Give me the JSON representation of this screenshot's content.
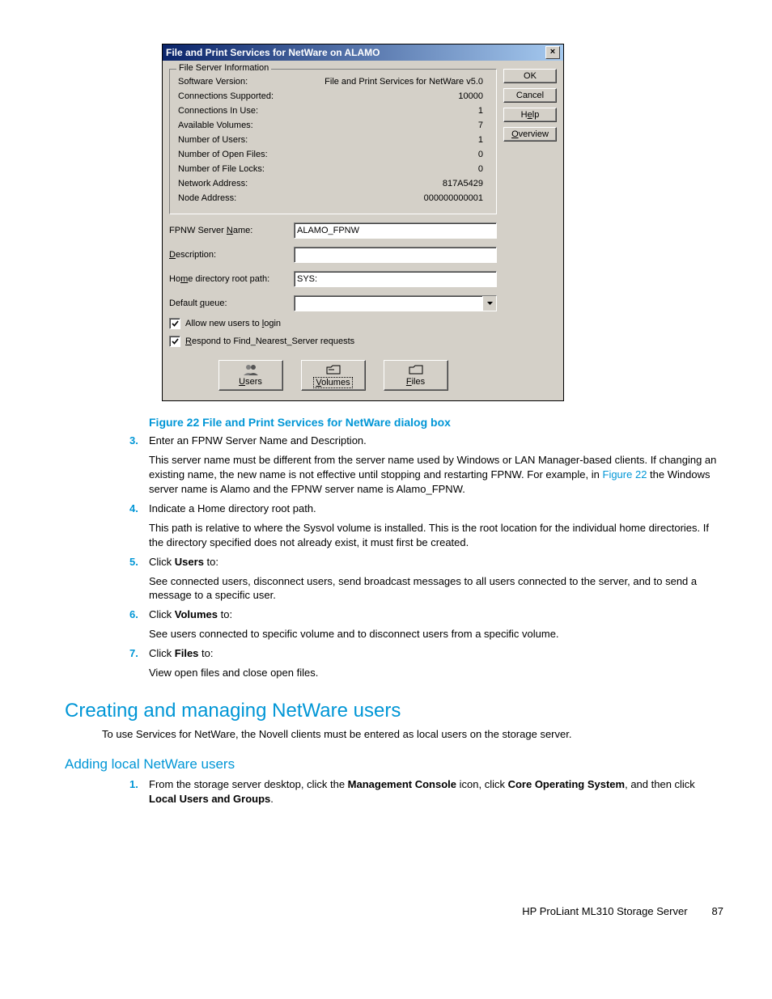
{
  "dialog": {
    "title": "File and Print Services for NetWare on ALAMO",
    "buttons": {
      "ok": "OK",
      "cancel": "Cancel",
      "help_pre": "H",
      "help_u": "e",
      "help_post": "lp",
      "overview_u": "O",
      "overview_post": "verview"
    },
    "fieldset_legend": "File Server Information",
    "info": {
      "sw_version_lbl": "Software Version:",
      "sw_version_val": "File and Print Services for NetWare v5.0",
      "conn_sup_lbl": "Connections Supported:",
      "conn_sup_val": "10000",
      "conn_use_lbl": "Connections In Use:",
      "conn_use_val": "1",
      "avail_vol_lbl": "Available Volumes:",
      "avail_vol_val": "7",
      "num_users_lbl": "Number of Users:",
      "num_users_val": "1",
      "open_files_lbl": "Number of Open Files:",
      "open_files_val": "0",
      "file_locks_lbl": "Number of File Locks:",
      "file_locks_val": "0",
      "net_addr_lbl": "Network Address:",
      "net_addr_val": "817A5429",
      "node_addr_lbl": "Node Address:",
      "node_addr_val": "000000000001"
    },
    "form": {
      "server_name_pre": "FPNW Server ",
      "server_name_u": "N",
      "server_name_post": "ame:",
      "server_name_val": "ALAMO_FPNW",
      "desc_u": "D",
      "desc_post": "escription:",
      "desc_val": "",
      "home_pre": "Ho",
      "home_u": "m",
      "home_post": "e directory root path:",
      "home_val": "SYS:",
      "queue_pre": "Default ",
      "queue_u": "q",
      "queue_post": "ueue:",
      "queue_val": ""
    },
    "checks": {
      "allow_pre": "Allow new users to ",
      "allow_u": "l",
      "allow_post": "ogin",
      "respond_u": "R",
      "respond_post": "espond to Find_Nearest_Server requests"
    },
    "bbuttons": {
      "users_u": "U",
      "users_post": "sers",
      "volumes_u": "V",
      "volumes_post": "olumes",
      "files_u": "F",
      "files_post": "iles"
    }
  },
  "doc": {
    "fig_caption": "Figure 22 File and Print Services for NetWare dialog box",
    "step3_num": "3.",
    "step3": "Enter an FPNW Server Name and Description.",
    "step3_para_a": "This server name must be different from the server name used by Windows or LAN Manager-based clients. If changing an existing name, the new name is not effective until stopping and restarting FPNW. For example, in ",
    "step3_xref": "Figure 22",
    "step3_para_b": " the Windows server name is Alamo and the FPNW server name is Alamo_FPNW.",
    "step4_num": "4.",
    "step4": "Indicate a Home directory root path.",
    "step4_para": "This path is relative to where the Sysvol volume is installed. This is the root location for the individual home directories. If the directory specified does not already exist, it must first be created.",
    "step5_num": "5.",
    "step5_a": "Click ",
    "step5_b": "Users",
    "step5_c": " to:",
    "step5_para": "See connected users, disconnect users, send broadcast messages to all users connected to the server, and to send a message to a specific user.",
    "step6_num": "6.",
    "step6_a": "Click ",
    "step6_b": "Volumes",
    "step6_c": " to:",
    "step6_para": "See users connected to specific volume and to disconnect users from a specific volume.",
    "step7_num": "7.",
    "step7_a": "Click ",
    "step7_b": "Files",
    "step7_c": " to:",
    "step7_para": "View open files and close open files.",
    "h1": "Creating and managing NetWare users",
    "h1_para": "To use Services for NetWare, the Novell clients must be entered as local users on the storage server.",
    "h2": "Adding local NetWare users",
    "sub1_num": "1.",
    "sub1_a": "From the storage server desktop, click the ",
    "sub1_b": "Management Console",
    "sub1_c": " icon, click ",
    "sub1_d": "Core Operating System",
    "sub1_e": ", and then click ",
    "sub1_f": "Local Users and Groups",
    "sub1_g": ".",
    "footer_product": "HP ProLiant ML310 Storage Server",
    "footer_page": "87"
  }
}
